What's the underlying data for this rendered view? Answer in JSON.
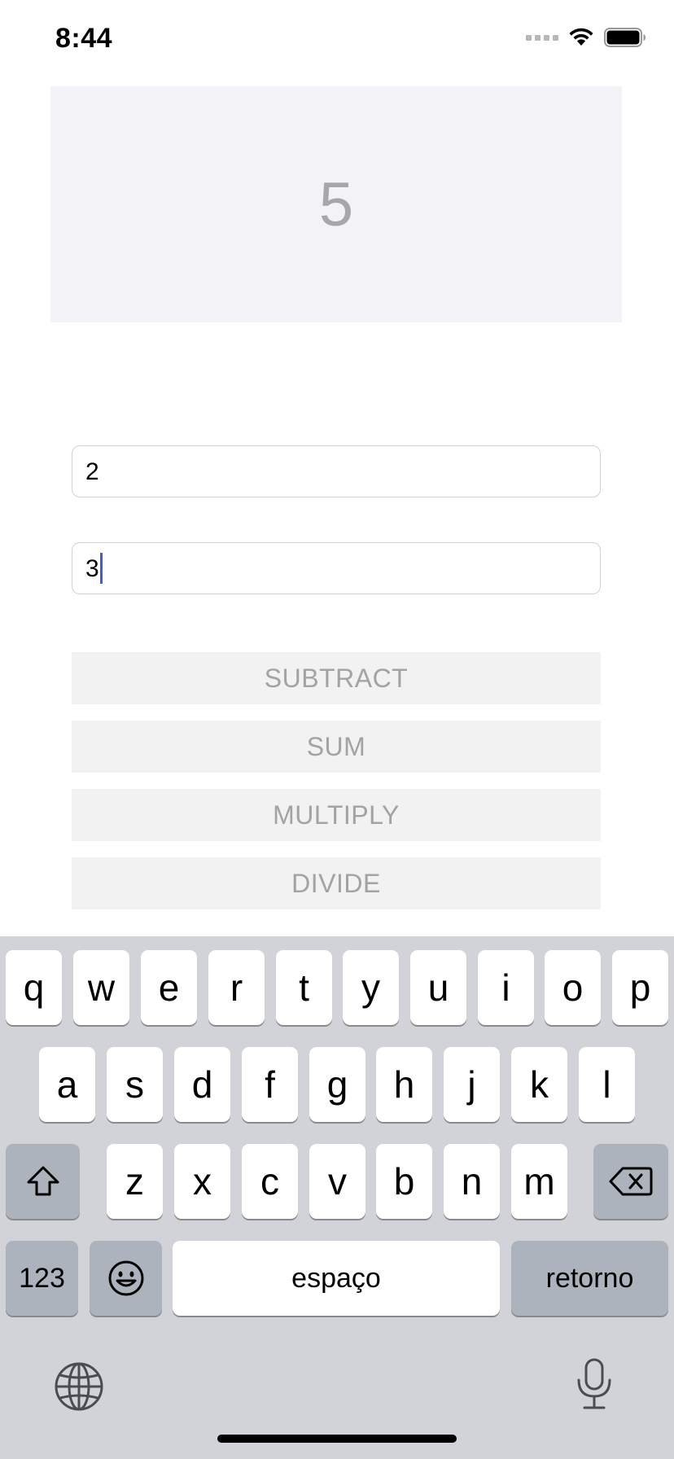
{
  "status": {
    "time": "8:44"
  },
  "result": {
    "value": "5"
  },
  "inputs": {
    "first": "2",
    "second": "3"
  },
  "buttons": {
    "subtract": "SUBTRACT",
    "sum": "SUM",
    "multiply": "MULTIPLY",
    "divide": "DIVIDE"
  },
  "keyboard": {
    "row1": [
      "q",
      "w",
      "e",
      "r",
      "t",
      "y",
      "u",
      "i",
      "o",
      "p"
    ],
    "row2": [
      "a",
      "s",
      "d",
      "f",
      "g",
      "h",
      "j",
      "k",
      "l"
    ],
    "row3": [
      "z",
      "x",
      "c",
      "v",
      "b",
      "n",
      "m"
    ],
    "numbers_label": "123",
    "space_label": "espaço",
    "return_label": "retorno"
  },
  "icons": [
    "signal-icon",
    "wifi-icon",
    "battery-icon",
    "shift-icon",
    "backspace-icon",
    "emoji-icon",
    "globe-icon",
    "microphone-icon"
  ]
}
